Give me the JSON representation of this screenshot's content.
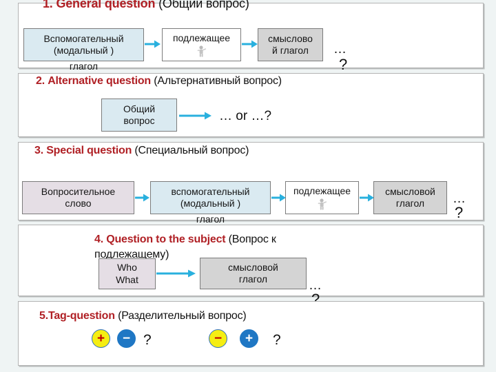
{
  "slide": {
    "background_color": "#eff4f4",
    "accent_color": "#b02025",
    "arrow_color": "#29b0de"
  },
  "sections": [
    {
      "id": "general-question",
      "number": "1.",
      "title_en": "General question",
      "title_ru": "(Общий вопрос)",
      "boxes": [
        {
          "label_line1": "Вспомогательный",
          "label_line2": "(модальный )",
          "overflow": "глагол",
          "fill": "#daeaf1"
        },
        {
          "label_line1": "подлежащее",
          "icon": "person-icon",
          "fill": "#ffffff"
        },
        {
          "label_line1": "смыслово",
          "label_line2": "й глагол",
          "fill": "#d4d4d4"
        }
      ],
      "trailing_dots": "…",
      "trailing_question": "?"
    },
    {
      "id": "alternative-question",
      "number": "2.",
      "title_en": "Alternative  question",
      "title_ru": "(Альтернативный вопрос)",
      "boxes": [
        {
          "label_line1": "Общий",
          "label_line2": "вопрос",
          "fill": "#daeaf1"
        }
      ],
      "formula": "… or …?"
    },
    {
      "id": "special-question",
      "number": "3.",
      "title_en": "Special question",
      "title_ru": "(Специальный вопрос)",
      "boxes": [
        {
          "label_line1": "Вопросительное",
          "label_line2": "слово",
          "fill": "#e5dee5"
        },
        {
          "label_line1": "вспомогательный",
          "label_line2": "(модальный )",
          "overflow": "глагол",
          "fill": "#daeaf1"
        },
        {
          "label_line1": "подлежащее",
          "icon": "person-icon",
          "fill": "#ffffff"
        },
        {
          "label_line1": "смысловой",
          "label_line2": "глагол",
          "fill": "#d4d4d4"
        }
      ],
      "trailing_dots": "…",
      "trailing_question": "?"
    },
    {
      "id": "question-to-the-subject",
      "number": "4.",
      "title_en": "Question to the subject",
      "title_ru": "(Вопрос к подлежащему)",
      "boxes": [
        {
          "label_line1": "Who",
          "label_line2": "What",
          "fill": "#e5dee5"
        },
        {
          "label_line1": "смысловой",
          "label_line2": "глагол",
          "fill": "#d4d4d4"
        }
      ],
      "trailing_dots": "…",
      "trailing_question": "?"
    },
    {
      "id": "tag-question",
      "number": "5.",
      "title_en": "Tag-question",
      "title_ru": "(Разделительный вопрос)",
      "pairs": [
        {
          "first_sign": "+",
          "first_color": "#f5ee13",
          "second_sign": "−",
          "second_color": "#1f77c4",
          "question": "?"
        },
        {
          "first_sign": "−",
          "first_color": "#f5ee13",
          "second_sign": "+",
          "second_color": "#1f77c4",
          "question": "?"
        }
      ]
    }
  ]
}
